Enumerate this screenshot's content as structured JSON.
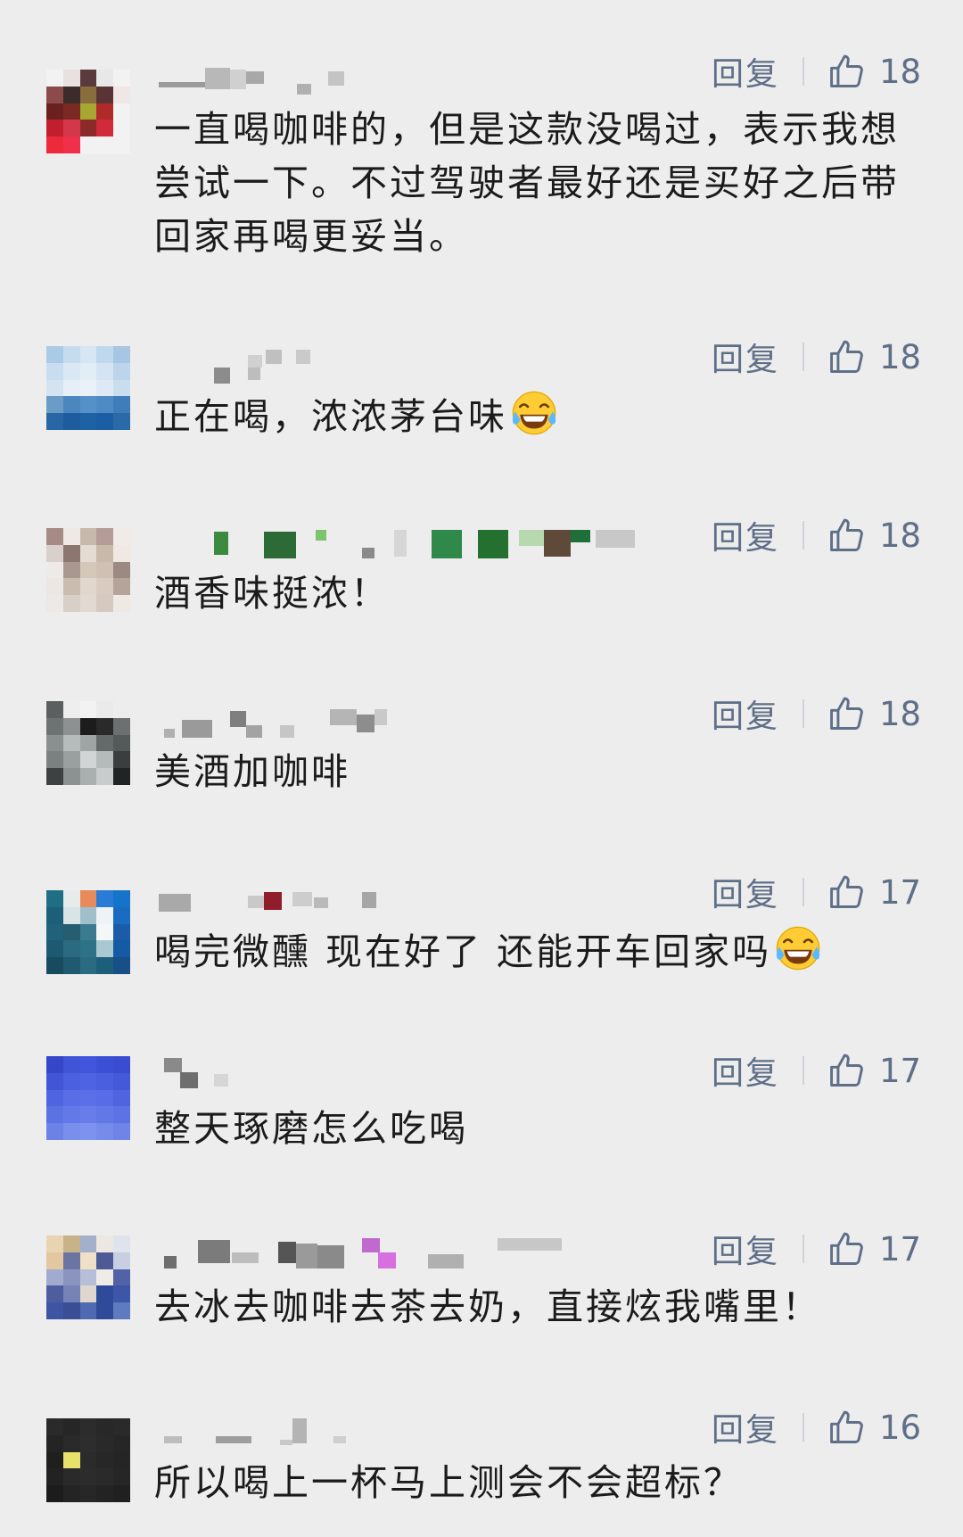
{
  "reply_label": "回复",
  "comments": [
    {
      "text": "一直喝咖啡的，但是这款没喝过，表示我想尝试一下。不过驾驶者最好还是买好之后带回家再喝更妥当。",
      "likes": "18",
      "emoji": false
    },
    {
      "text": "正在喝，浓浓茅台味",
      "likes": "18",
      "emoji": true,
      "emoji_name": "tears-of-joy-emoji"
    },
    {
      "text": "酒香味挺浓！",
      "likes": "18",
      "emoji": false
    },
    {
      "text": "美酒加咖啡",
      "likes": "18",
      "emoji": false
    },
    {
      "text": "喝完微醺 现在好了 还能开车回家吗",
      "likes": "17",
      "emoji": true,
      "emoji_name": "tears-of-joy-emoji"
    },
    {
      "text": "整天琢磨怎么吃喝",
      "likes": "17",
      "emoji": false
    },
    {
      "text": "去冰去咖啡去茶去奶，直接炫我嘴里！",
      "likes": "17",
      "emoji": false
    },
    {
      "text": "所以喝上一杯马上测会不会超标？",
      "likes": "16",
      "emoji": false
    }
  ],
  "icons": {
    "like": "thumbs-up-icon",
    "emoji": "tears-of-joy-emoji"
  },
  "colors": {
    "background": "#ededed",
    "action_text": "#5f6f88",
    "comment_text": "#1b1b1b"
  }
}
